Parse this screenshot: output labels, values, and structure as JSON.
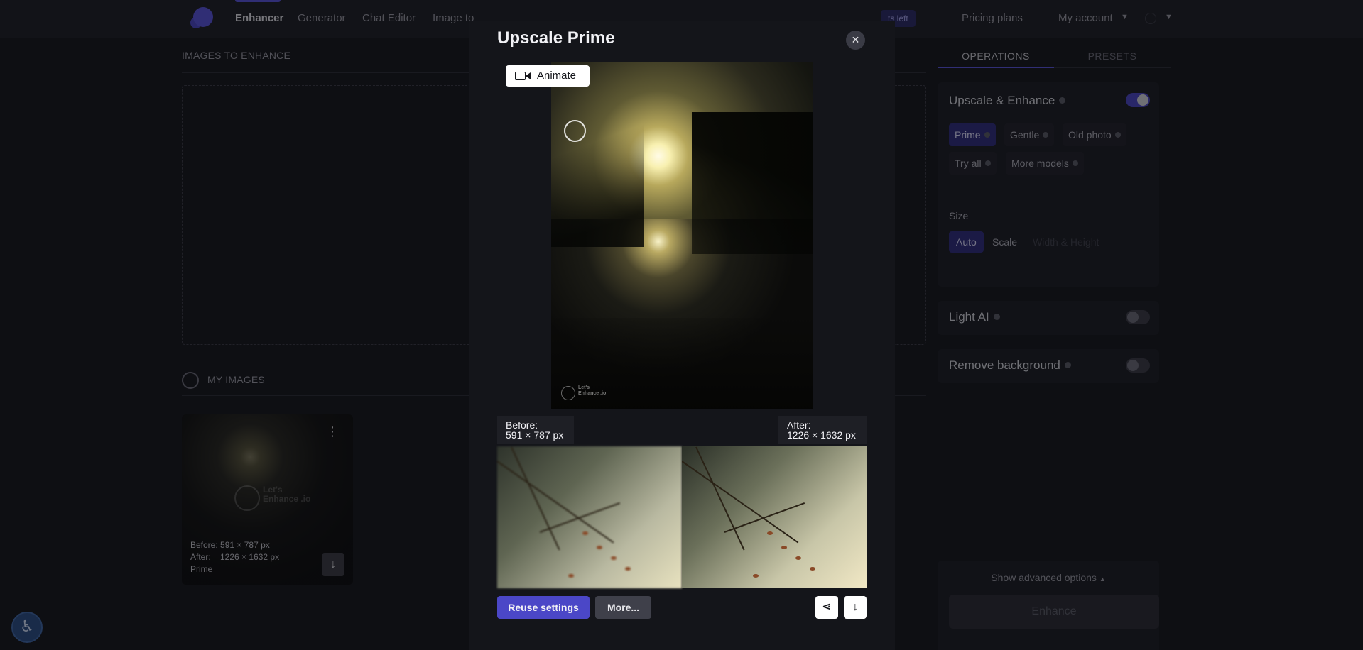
{
  "nav": {
    "items": [
      "Enhancer",
      "Generator",
      "Chat Editor",
      "Image to"
    ],
    "credits_text": "ts left",
    "pricing": "Pricing plans",
    "account": "My account"
  },
  "left": {
    "images_to_enhance": "IMAGES TO ENHANCE",
    "my_images": "MY IMAGES",
    "card": {
      "before": "Before: 591 × 787 px",
      "after": "After:    1226 × 1632 px",
      "model": "Prime",
      "watermark": "Let's Enhance .io"
    }
  },
  "right": {
    "tabs": [
      "OPERATIONS",
      "PRESETS"
    ],
    "upscale_title": "Upscale & Enhance",
    "upscale_on": true,
    "models": [
      "Prime",
      "Gentle",
      "Old photo",
      "Try all",
      "More models"
    ],
    "selected_model": "Prime",
    "size_label": "Size",
    "size_options": [
      "Auto",
      "Scale",
      "Width & Height"
    ],
    "light_ai": "Light AI",
    "light_ai_on": false,
    "remove_bg": "Remove background",
    "remove_bg_on": false,
    "advanced": "Show advanced options",
    "enhance": "Enhance"
  },
  "modal": {
    "title": "Upscale Prime",
    "animate": "Animate",
    "before_label": "Before:",
    "before_size": "591 × 787 px",
    "after_label": "After:",
    "after_size": "1226 × 1632 px",
    "reuse": "Reuse settings",
    "more": "More...",
    "watermark": "Let's Enhance .io"
  },
  "colors": {
    "accent": "#5854de",
    "background": "#15161b",
    "panel": "#1b1c22"
  }
}
